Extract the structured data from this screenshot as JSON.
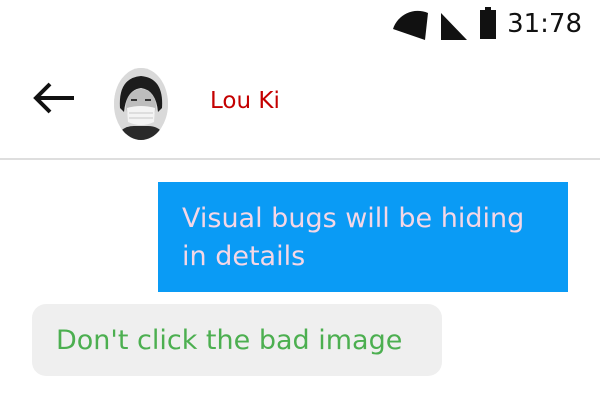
{
  "status_bar": {
    "time": "31:78",
    "icons": [
      "wifi-icon",
      "cellular-signal-icon",
      "battery-icon"
    ]
  },
  "header": {
    "back_icon": "arrow-left-icon",
    "avatar": "contact-avatar",
    "contact_name": "Lou Ki"
  },
  "messages": [
    {
      "direction": "sent",
      "text": "Visual bugs will be hiding in details"
    },
    {
      "direction": "received",
      "text": "Don't click the bad image"
    }
  ],
  "colors": {
    "sent_bubble": "#0a9bf5",
    "sent_text": "#f5d7e6",
    "received_bubble": "#efefef",
    "received_text": "#4caf50",
    "contact_name": "#c40000",
    "divider": "#dedede"
  }
}
